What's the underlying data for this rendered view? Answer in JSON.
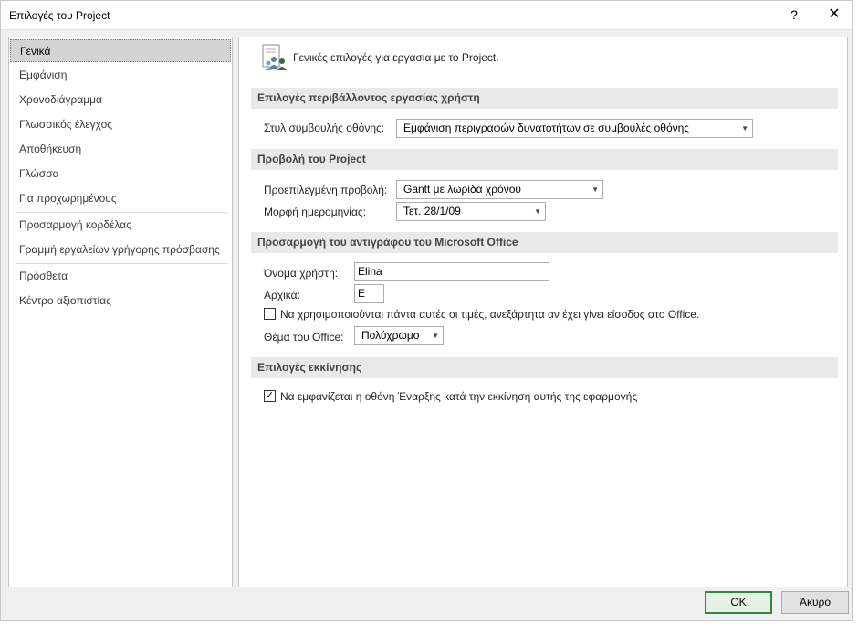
{
  "window": {
    "title": "Επιλογές του Project",
    "help_glyph": "?",
    "close_glyph": "✕"
  },
  "sidebar": {
    "items": [
      {
        "label": "Γενικά"
      },
      {
        "label": "Εμφάνιση"
      },
      {
        "label": "Χρονοδιάγραμμα"
      },
      {
        "label": "Γλωσσικός έλεγχος"
      },
      {
        "label": "Αποθήκευση"
      },
      {
        "label": "Γλώσσα"
      },
      {
        "label": "Για προχωρημένους"
      },
      {
        "label": "Προσαρμογή κορδέλας"
      },
      {
        "label": "Γραμμή εργαλείων γρήγορης πρόσβασης"
      },
      {
        "label": "Πρόσθετα"
      },
      {
        "label": "Κέντρο αξιοπιστίας"
      }
    ],
    "selected": "Γενικά"
  },
  "main": {
    "header": "Γενικές επιλογές για εργασία με το Project.",
    "header_icon": "people-options-icon",
    "sections": {
      "ui": {
        "title": "Επιλογές περιβάλλοντος εργασίας χρήστη",
        "tooltip_label": "Στυλ συμβουλής οθόνης:",
        "tooltip_value": "Εμφάνιση περιγραφών δυνατοτήτων σε συμβουλές οθόνης"
      },
      "view": {
        "title": "Προβολή του Project",
        "default_view_label": "Προεπιλεγμένη προβολή:",
        "default_view_value": "Gantt με λωρίδα χρόνου",
        "date_format_label": "Μορφή ημερομηνίας:",
        "date_format_value": "Τετ. 28/1/09"
      },
      "personalize": {
        "title": "Προσαρμογή του αντιγράφου του Microsoft Office",
        "username_label": "Όνομα χρήστη:",
        "username_value": "Elina",
        "initials_label": "Αρχικά:",
        "initials_value": "E",
        "always_use_label": "Να χρησιμοποιούνται πάντα αυτές οι τιμές, ανεξάρτητα αν έχει γίνει είσοδος στο Office.",
        "always_use_checked": false,
        "theme_label": "Θέμα του Office:",
        "theme_value": "Πολύχρωμο"
      },
      "startup": {
        "title": "Επιλογές εκκίνησης",
        "show_start_label": "Να εμφανίζεται η οθόνη Έναρξης κατά την εκκίνηση αυτής της εφαρμογής",
        "show_start_checked": true
      }
    }
  },
  "footer": {
    "ok_label": "OK",
    "cancel_label": "Άκυρο"
  },
  "glyphs": {
    "dropdown_arrow": "▼",
    "check": "✓",
    "accent_color": "#2f8a3f"
  }
}
